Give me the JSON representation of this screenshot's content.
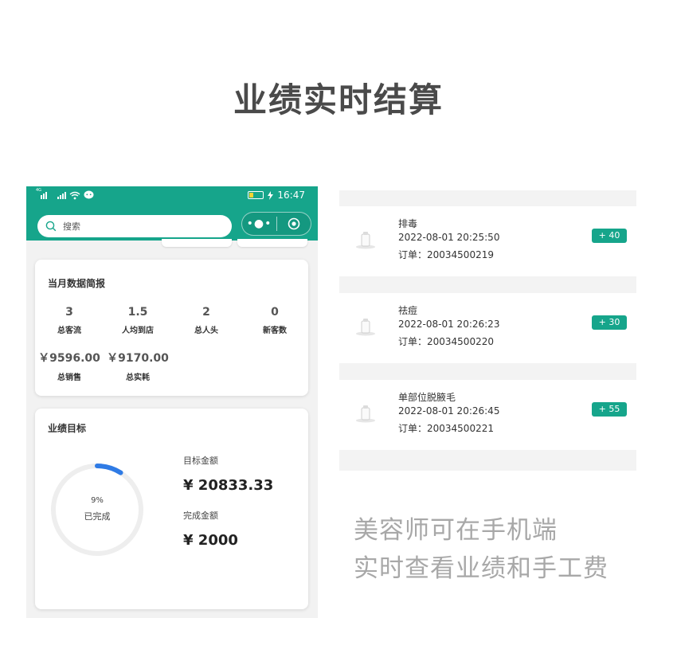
{
  "headline": "业绩实时结算",
  "phone": {
    "status": {
      "network_tag": "4G",
      "time": "16:47"
    },
    "search": {
      "placeholder": "搜索"
    },
    "capsule": {
      "more": "•●•"
    },
    "summary": {
      "title": "当月数据简报",
      "stats": [
        {
          "value": "3",
          "label": "总客流"
        },
        {
          "value": "1.5",
          "label": "人均到店"
        },
        {
          "value": "2",
          "label": "总人头"
        },
        {
          "value": "0",
          "label": "新客数"
        },
        {
          "value": "￥9596.00",
          "label": "总销售"
        },
        {
          "value": "￥9170.00",
          "label": "总实耗"
        }
      ]
    },
    "goal": {
      "title": "业绩目标",
      "progress_percent": 9,
      "progress_text": "9%",
      "progress_sub": "已完成",
      "target_label": "目标金额",
      "target_value": "¥ 20833.33",
      "done_label": "完成金额",
      "done_value": "¥ 2000",
      "progress_color": "#2f7be5",
      "track_color": "#eeeeee"
    }
  },
  "records": [
    {
      "name": "排毒",
      "time": "2022-08-01 20:25:50",
      "order": "订单：20034500219",
      "badge": "+ 40"
    },
    {
      "name": "祛痘",
      "time": "2022-08-01 20:26:23",
      "order": "订单：20034500220",
      "badge": "+ 30"
    },
    {
      "name": "单部位脱腋毛",
      "time": "2022-08-01 20:26:45",
      "order": "订单：20034500221",
      "badge": "+ 55"
    }
  ],
  "caption": {
    "line1": "美容师可在手机端",
    "line2": "实时查看业绩和手工费"
  },
  "colors": {
    "brand": "#16a58b",
    "badge": "#16a58b"
  }
}
